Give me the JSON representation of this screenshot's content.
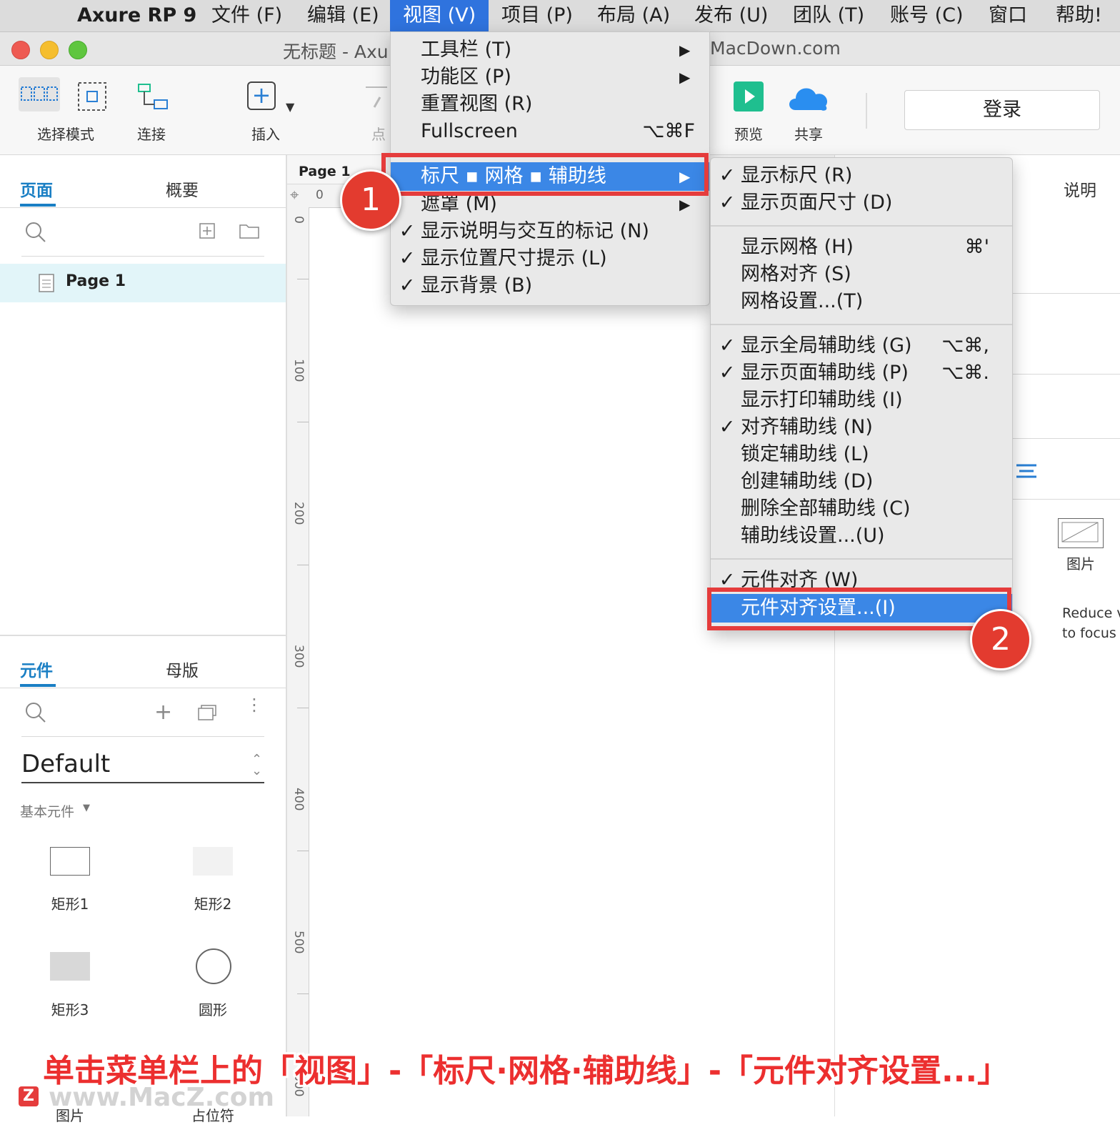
{
  "menubar": {
    "app_name": "Axure RP 9",
    "items": [
      "文件 (F)",
      "编辑 (E)",
      "视图 (V)",
      "项目 (P)",
      "布局 (A)",
      "发布 (U)",
      "团队 (T)",
      "账号 (C)",
      "窗口",
      "帮助!"
    ]
  },
  "window": {
    "title": "无标题 - Axu",
    "title_tail": "MacDown.com"
  },
  "toolbar": {
    "select_mode": "选择模式",
    "connect": "连接",
    "insert": "插入",
    "point": "点",
    "preview": "预览",
    "share": "共享",
    "login": "登录"
  },
  "left_panel": {
    "tab_pages": "页面",
    "tab_outline": "概要",
    "page_item": "Page 1",
    "tab_widgets": "元件",
    "tab_masters": "母版",
    "library": "Default",
    "category": "基本元件",
    "widgets": [
      "矩形1",
      "矩形2",
      "矩形3",
      "圆形"
    ],
    "widgets_row3": [
      "图片",
      "占位符"
    ]
  },
  "canvas": {
    "tab_label": "Page 1",
    "ruler_h_zero": "0",
    "ruler_marks": [
      "0",
      "100",
      "200",
      "300",
      "400",
      "500",
      "600"
    ]
  },
  "right_panel": {
    "notes_tab": "说明",
    "image_label": "图片",
    "reduce_text_1": "Reduce v",
    "reduce_text_2": "to focus c"
  },
  "view_menu": {
    "items": [
      {
        "label": "工具栏 (T)",
        "submenu": true
      },
      {
        "label": "功能区 (P)",
        "submenu": true
      },
      {
        "label": "重置视图 (R)"
      },
      {
        "label": "Fullscreen",
        "shortcut": "⌥⌘F"
      },
      {
        "label": "标尺 ▪ 网格 ▪ 辅助线",
        "submenu": true,
        "highlighted": true
      },
      {
        "label": "遮罩 (M)",
        "submenu": true
      },
      {
        "label": "显示说明与交互的标记 (N)",
        "checked": true
      },
      {
        "label": "显示位置尺寸提示 (L)",
        "checked": true
      },
      {
        "label": "显示背景 (B)",
        "checked": true
      }
    ]
  },
  "sub_menu": {
    "items": [
      {
        "label": "显示标尺 (R)",
        "checked": true
      },
      {
        "label": "显示页面尺寸 (D)",
        "checked": true
      },
      {
        "label": "显示网格 (H)",
        "shortcut": "⌘'"
      },
      {
        "label": "网格对齐 (S)"
      },
      {
        "label": "网格设置...(T)"
      },
      {
        "label": "显示全局辅助线 (G)",
        "checked": true,
        "shortcut": "⌥⌘,"
      },
      {
        "label": "显示页面辅助线 (P)",
        "checked": true,
        "shortcut": "⌥⌘."
      },
      {
        "label": "显示打印辅助线 (I)"
      },
      {
        "label": "对齐辅助线 (N)",
        "checked": true
      },
      {
        "label": "锁定辅助线 (L)"
      },
      {
        "label": "创建辅助线 (D)"
      },
      {
        "label": "删除全部辅助线 (C)"
      },
      {
        "label": "辅助线设置...(U)"
      },
      {
        "label": "元件对齐 (W)",
        "checked": true
      },
      {
        "label": "元件对齐设置...(I)",
        "highlighted": true
      }
    ]
  },
  "annotations": {
    "badge1": "1",
    "badge2": "2",
    "caption": "单击菜单栏上的「视图」-「标尺·网格·辅助线」-「元件对齐设置...」",
    "watermark": "www.MacZ.com",
    "watermark_logo": "Z"
  },
  "colors": {
    "accent": "#1a7fc4",
    "menu_highlight": "#3b87e6",
    "annotation_red": "#e53c3c",
    "preview_green": "#1fbf8f",
    "cloud_blue": "#2a8ef0"
  }
}
